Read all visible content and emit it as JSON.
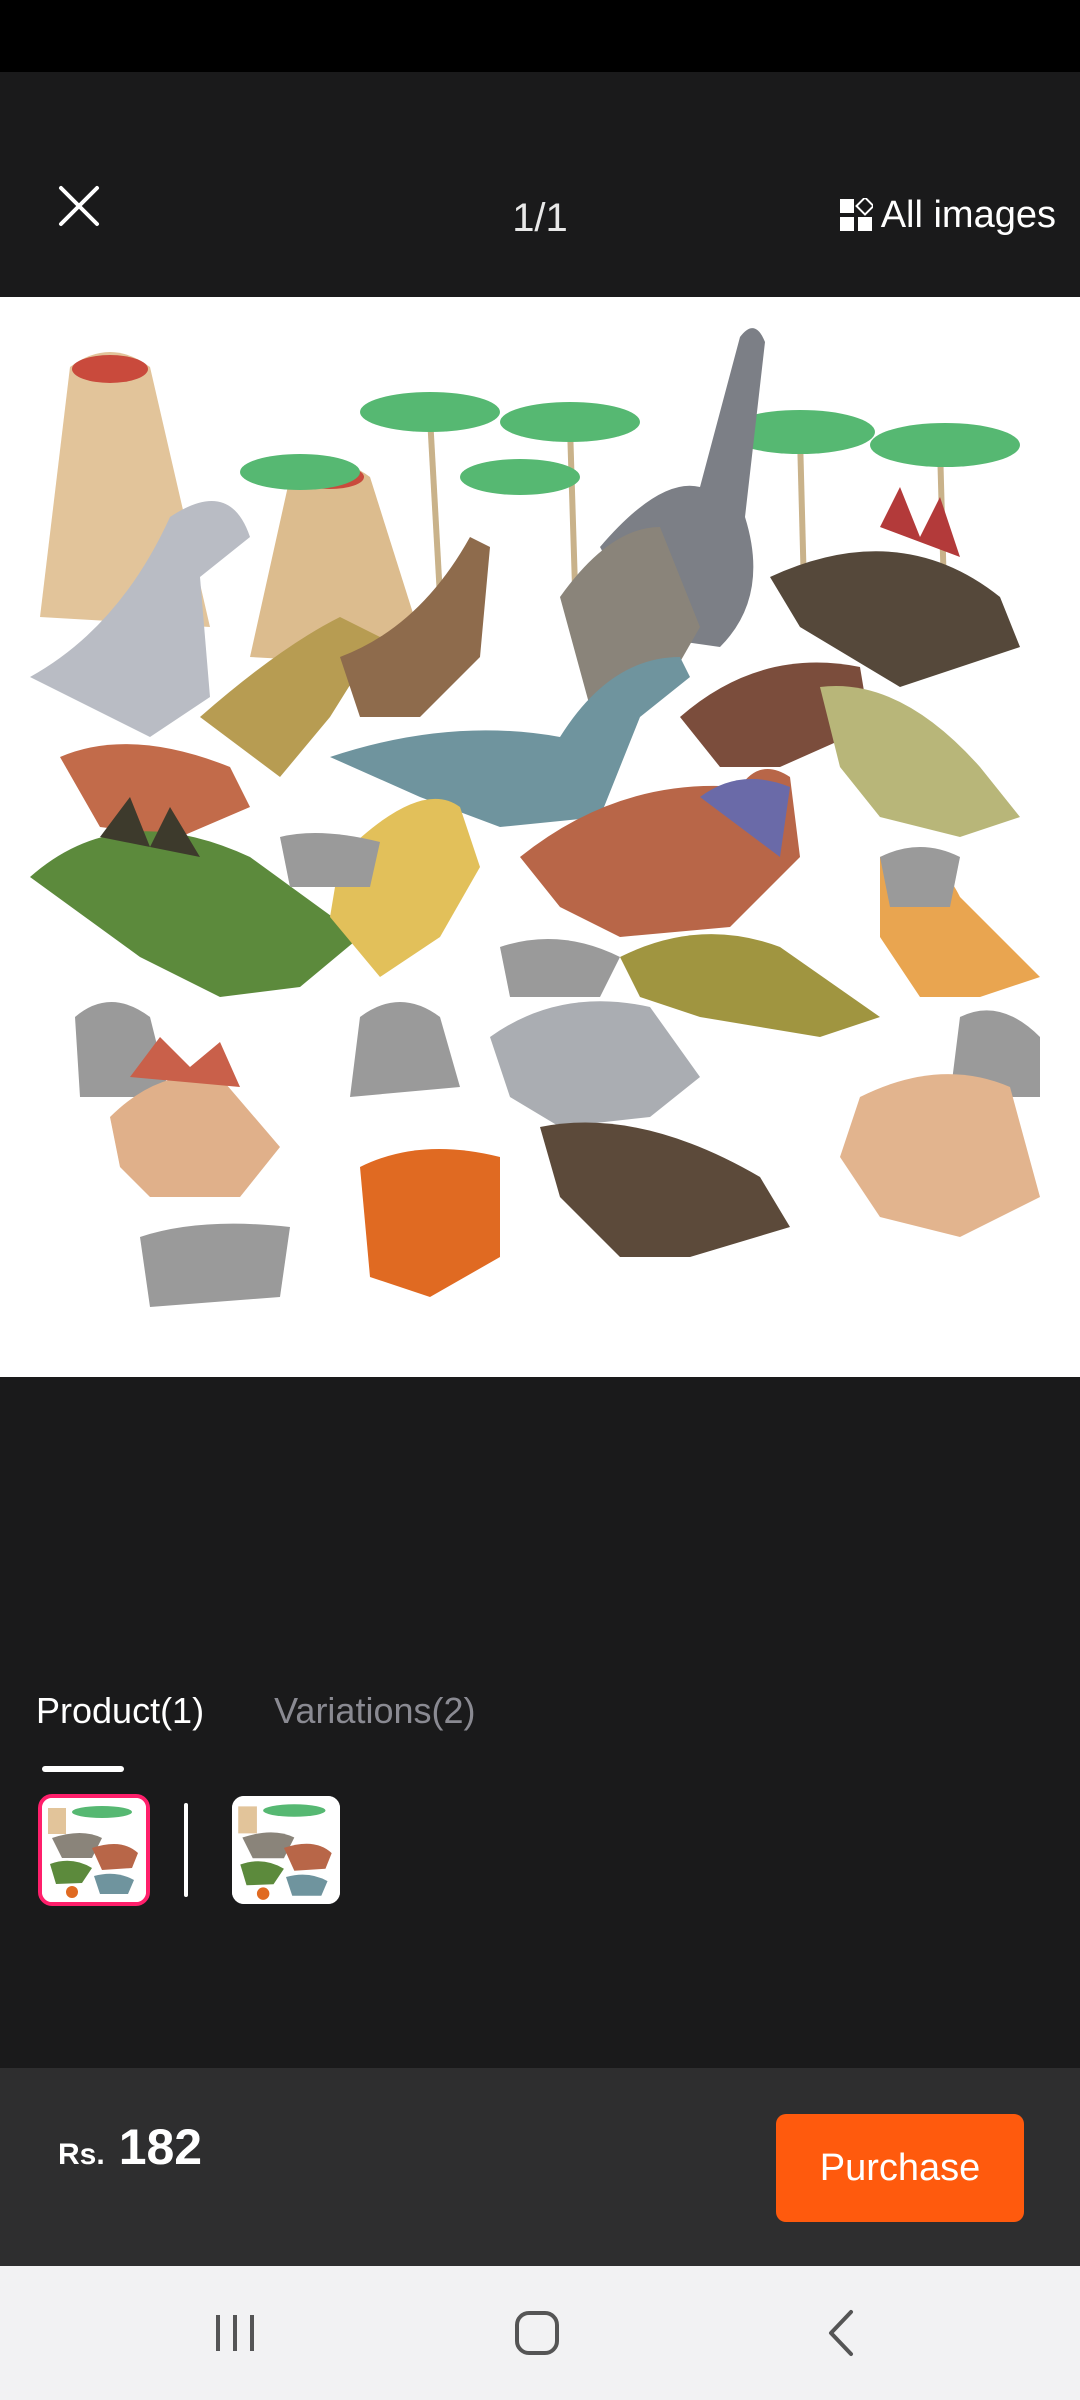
{
  "header": {
    "counter": "1/1",
    "all_images_label": "All images",
    "close_icon": "close-icon",
    "gallery_icon": "gallery-grid-icon"
  },
  "hero_image": {
    "description_icon": "product-photo"
  },
  "tabs": [
    {
      "label": "Product(1)",
      "active": true
    },
    {
      "label": "Variations(2)",
      "active": false
    }
  ],
  "footer": {
    "currency": "Rs.",
    "price": "182",
    "purchase_label": "Purchase"
  },
  "nav": {
    "recents_icon": "recents-icon",
    "home_icon": "home-icon",
    "back_icon": "back-icon"
  },
  "colors": {
    "accent": "#ff5a0d",
    "selected_border": "#ff1f6b",
    "background": "#1a1a1b",
    "panel": "#2e2e2f"
  }
}
